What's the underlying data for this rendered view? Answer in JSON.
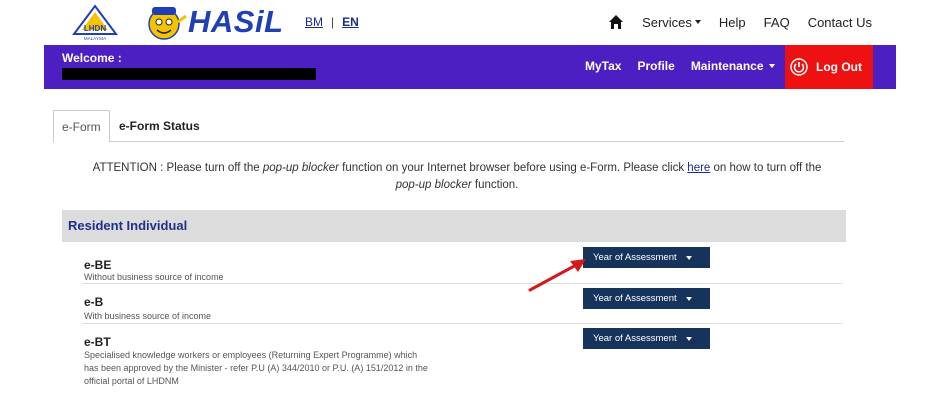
{
  "header": {
    "logo_text": "LHDN",
    "logo_subtext": "MALAYSIA",
    "brand": "HASiL",
    "lang_bm": "BM",
    "lang_sep": "|",
    "lang_en": "EN",
    "nav": {
      "services": "Services",
      "help": "Help",
      "faq": "FAQ",
      "contact": "Contact Us"
    }
  },
  "userbar": {
    "welcome": "Welcome :",
    "nav": {
      "mytax": "MyTax",
      "profile": "Profile",
      "maintenance": "Maintenance"
    },
    "logout": "Log Out"
  },
  "tabs": [
    {
      "label": "e-Form",
      "active": true
    },
    {
      "label": "e-Form Status",
      "active": false
    }
  ],
  "attention": {
    "t1": "ATTENTION : Please turn off the ",
    "t2": "pop-up blocker",
    "t3": " function on your Internet browser before using e-Form. Please click ",
    "link": "here",
    "t4": " on how to turn off the ",
    "t5": "pop-up blocker",
    "t6": " function."
  },
  "panel": {
    "title": "Resident Individual",
    "forms": [
      {
        "code": "e-BE",
        "desc": "Without business source of income",
        "button": "Year of Assessment"
      },
      {
        "code": "e-B",
        "desc": "With business source of income",
        "button": "Year of Assessment"
      },
      {
        "code": "e-BT",
        "desc": "Specialised knowledge workers or employees (Returning Expert Programme) which has been approved by the Minister - refer P.U (A) 344/2010 or P.U. (A) 151/2012 in the official portal of LHDNM",
        "button": "Year of Assessment"
      }
    ]
  },
  "colors": {
    "purple_bar": "#4b1fc2",
    "logout_red": "#ee1111",
    "button_navy": "#16335c",
    "panel_head": "#dcdcdc",
    "arrow": "#d11a1a"
  },
  "icons": [
    "lhdn-logo-icon",
    "hasil-mascot-icon",
    "home-icon",
    "logout-icon",
    "annotation-arrow-icon"
  ]
}
